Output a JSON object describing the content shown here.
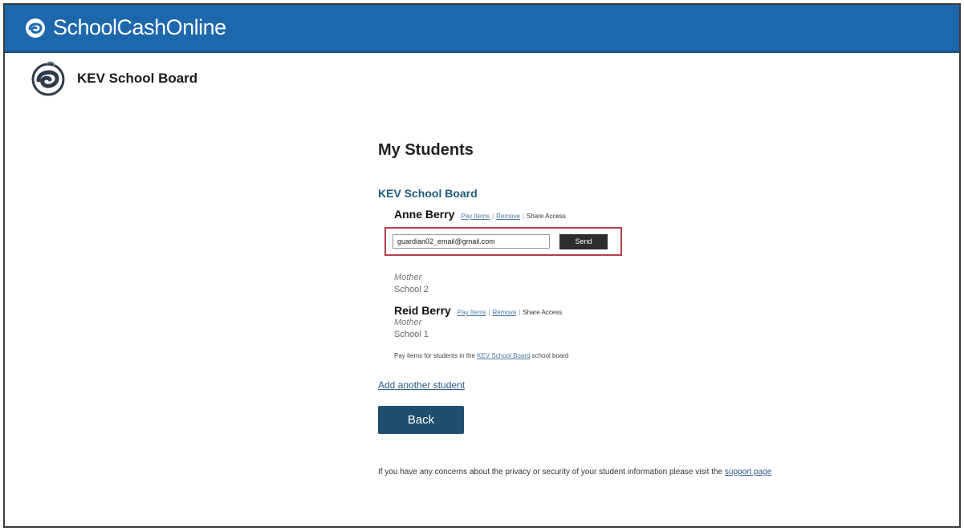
{
  "header": {
    "brand": "SchoolCashOnline",
    "brand_color": "#1d67ad"
  },
  "board": {
    "name": "KEV School Board"
  },
  "main": {
    "title": "My Students",
    "board_title": "KEV School Board",
    "link_pay": "Pay Items",
    "link_remove": "Remove",
    "link_share": "Share Access",
    "sep": "|",
    "students": [
      {
        "name": "Anne Berry",
        "relation": "Mother",
        "school": "School 2",
        "share_email": "guardian02_email@gmail.com",
        "send_label": "Send"
      },
      {
        "name": "Reid Berry",
        "relation": "Mother",
        "school": "School 1"
      }
    ],
    "note_prefix": "Pay items for students in the",
    "note_link": "KEV School Board",
    "note_suffix": "school board",
    "add_student": "Add another student",
    "back_label": "Back",
    "privacy_text": "If you have any concerns about the privacy or security of your student information please visit the",
    "privacy_link": "support page",
    "highlight_color": "#b3404a"
  }
}
